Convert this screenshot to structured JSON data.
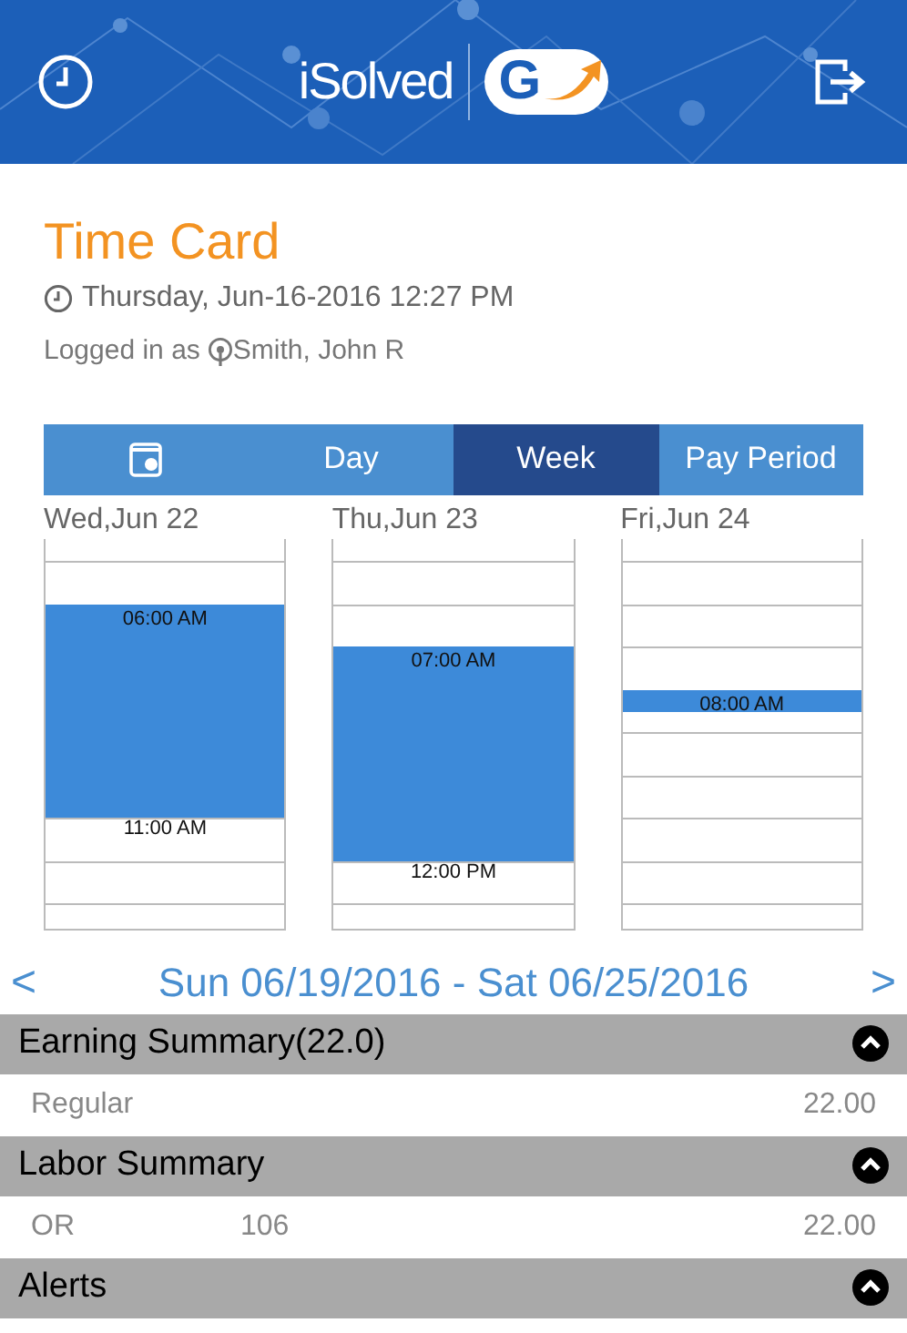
{
  "header": {
    "brand": "iSolved",
    "logo_letter": "G"
  },
  "title": "Time Card",
  "datetime": "Thursday, Jun-16-2016 12:27 PM",
  "logged_in": {
    "label": "Logged in as",
    "user": "Smith, John R"
  },
  "tabs": [
    {
      "kind": "icon",
      "selected": false
    },
    {
      "kind": "text",
      "label": "Day",
      "selected": false
    },
    {
      "kind": "text",
      "label": "Week",
      "selected": true
    },
    {
      "kind": "text",
      "label": "Pay Period",
      "selected": false
    }
  ],
  "days": [
    {
      "label": "Wed,Jun 22",
      "events": [
        {
          "start": "06:00 AM",
          "end": "11:00 AM"
        }
      ]
    },
    {
      "label": "Thu,Jun 23",
      "events": [
        {
          "start": "07:00 AM",
          "end": "12:00 PM"
        }
      ]
    },
    {
      "label": "Fri,Jun 24",
      "events": [
        {
          "start": "08:00 AM"
        }
      ]
    }
  ],
  "range": {
    "prev": "<",
    "label": "Sun 06/19/2016 - Sat 06/25/2016",
    "next": ">"
  },
  "sections": [
    {
      "title": "Earning Summary(22.0)",
      "expanded": true,
      "rows": [
        {
          "name": "Regular",
          "value": "22.00"
        }
      ]
    },
    {
      "title": "Labor Summary",
      "expanded": true,
      "rows": [
        {
          "name": "OR",
          "code": "106",
          "value": "22.00"
        }
      ]
    },
    {
      "title": "Alerts",
      "expanded": true
    }
  ]
}
